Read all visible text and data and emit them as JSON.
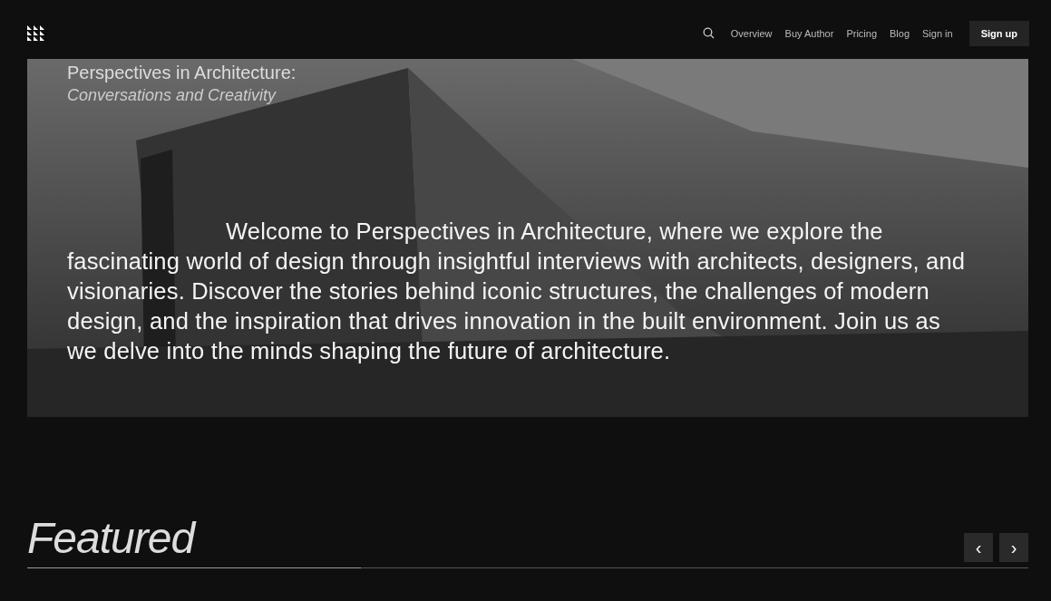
{
  "header": {
    "nav": [
      {
        "label": "Overview"
      },
      {
        "label": "Buy Author"
      },
      {
        "label": "Pricing"
      },
      {
        "label": "Blog"
      },
      {
        "label": "Sign in"
      }
    ],
    "cta": "Sign up"
  },
  "hero": {
    "kind": "picture",
    "title": "Perspectives in Architecture:",
    "subtitle": "Conversations and Creativity",
    "intro": "Welcome to Perspectives in Architecture, where we explore the fascinating world of design through insightful interviews with architects, designers, and visionaries. Discover the stories behind iconic structures, the challenges of modern design, and the inspiration that drives innovation in the built environment. Join us as we delve into the minds shaping the future of architecture."
  },
  "featured": {
    "title": "Featured",
    "prev": "‹",
    "next": "›"
  }
}
